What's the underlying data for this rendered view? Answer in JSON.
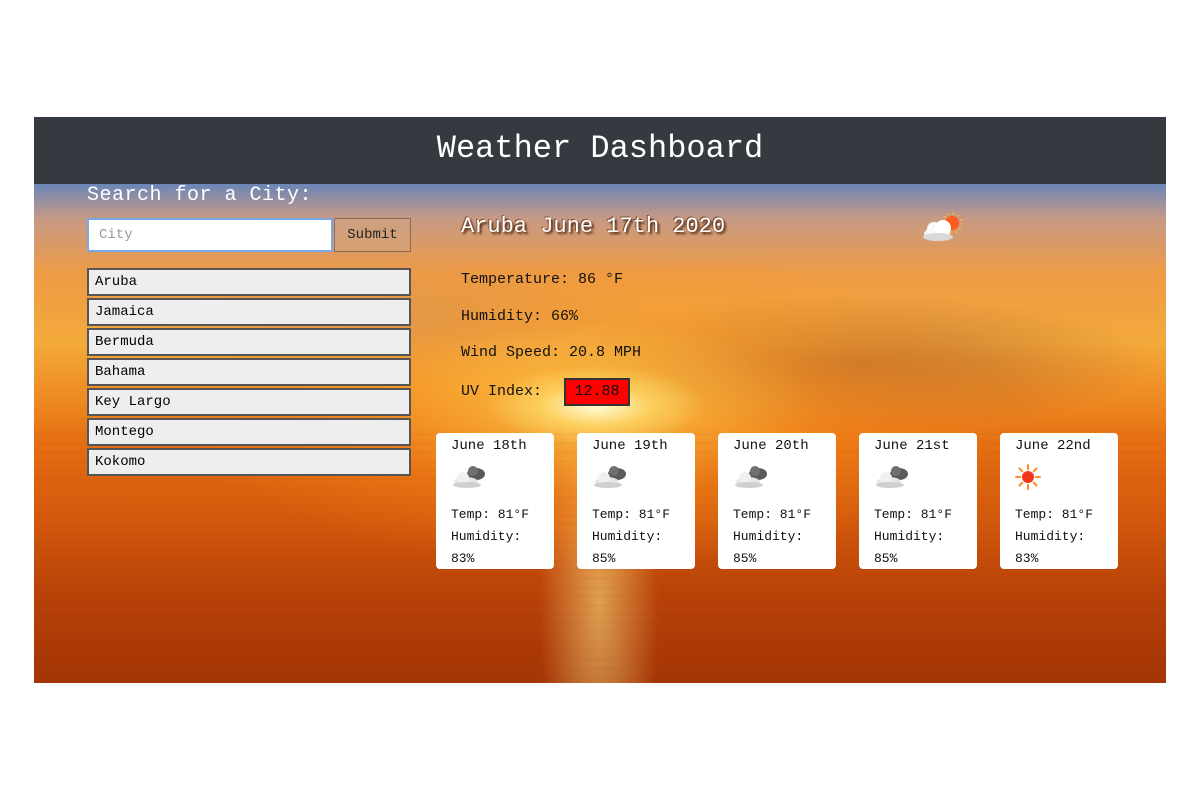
{
  "header": {
    "title": "Weather Dashboard"
  },
  "search": {
    "title": "Search for a City:",
    "placeholder": "City",
    "value": "",
    "submit_label": "Submit"
  },
  "history": [
    {
      "label": "Aruba"
    },
    {
      "label": "Jamaica"
    },
    {
      "label": "Bermuda"
    },
    {
      "label": "Bahama"
    },
    {
      "label": "Key Largo"
    },
    {
      "label": "Montego"
    },
    {
      "label": "Kokomo"
    }
  ],
  "current": {
    "title": "Aruba June 17th 2020",
    "icon": "partly-cloudy-sun-icon",
    "temperature": "Temperature: 86 °F",
    "humidity": "Humidity: 66%",
    "wind": "Wind Speed: 20.8 MPH",
    "uv_label": "UV Index:",
    "uv_value": "12.88",
    "uv_color": "#ff0000"
  },
  "forecast": [
    {
      "date": "June 18th",
      "icon": "clouds-icon",
      "temp": "Temp: 81°F",
      "humidity_label": "Humidity:",
      "humidity_value": "83%"
    },
    {
      "date": "June 19th",
      "icon": "clouds-icon",
      "temp": "Temp: 81°F",
      "humidity_label": "Humidity:",
      "humidity_value": "85%"
    },
    {
      "date": "June 20th",
      "icon": "clouds-icon",
      "temp": "Temp: 81°F",
      "humidity_label": "Humidity:",
      "humidity_value": "85%"
    },
    {
      "date": "June 21st",
      "icon": "clouds-icon",
      "temp": "Temp: 81°F",
      "humidity_label": "Humidity:",
      "humidity_value": "85%"
    },
    {
      "date": "June 22nd",
      "icon": "sun-icon",
      "temp": "Temp: 81°F",
      "humidity_label": "Humidity:",
      "humidity_value": "83%"
    }
  ],
  "colors": {
    "header_bg": "#343a40",
    "uv_badge": "#ff0000",
    "input_border": "#7aa7e6"
  }
}
